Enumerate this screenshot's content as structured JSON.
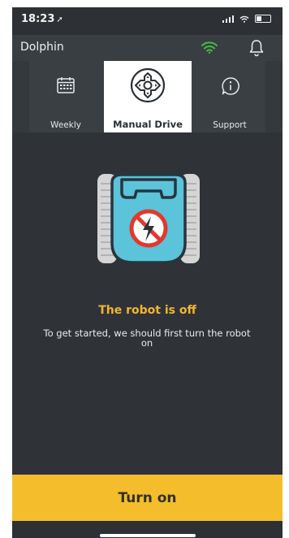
{
  "status_bar": {
    "time": "18:23",
    "location_glyph": "➚"
  },
  "app_bar": {
    "title": "Dolphin",
    "wifi_icon": "wifi-icon",
    "bell_icon": "bell-icon",
    "wifi_color": "#3fbf3f"
  },
  "tabs": [
    {
      "label": "Weekly",
      "icon": "calendar-icon"
    },
    {
      "label": "Manual Drive",
      "icon": "joystick-icon",
      "active": true
    },
    {
      "label": "Support",
      "icon": "info-icon"
    }
  ],
  "main": {
    "status_title": "The robot is off",
    "status_message": "To get started, we should first turn the robot on",
    "accent_color": "#f2b531"
  },
  "action": {
    "turn_on_label": "Turn on",
    "button_color": "#f3bd2b"
  }
}
